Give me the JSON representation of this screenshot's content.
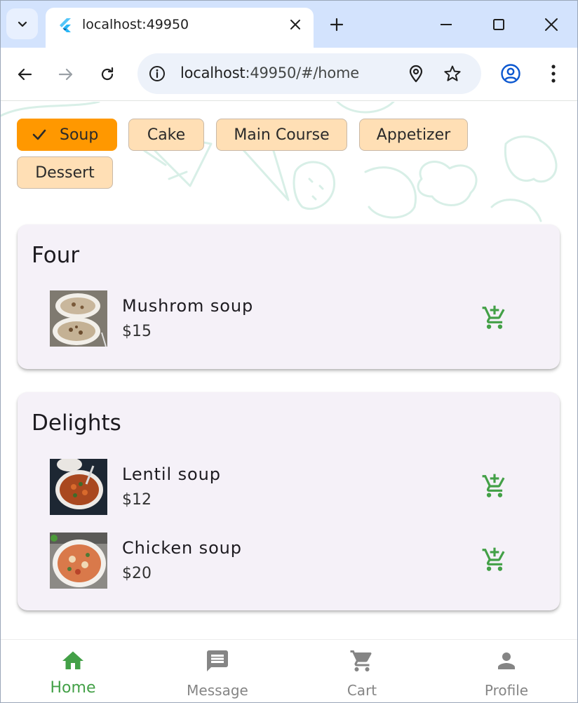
{
  "browser": {
    "tab_title": "localhost:49950",
    "url_host": "localhost",
    "url_path": ":49950/#/home"
  },
  "categories": {
    "selected": "Soup",
    "chips": [
      "Soup",
      "Cake",
      "Main Course",
      "Appetizer",
      "Dessert"
    ]
  },
  "sections": [
    {
      "title": "Four",
      "items": [
        {
          "name": "Mushrom soup",
          "price": "$15"
        }
      ]
    },
    {
      "title": "Delights",
      "items": [
        {
          "name": "Lentil soup",
          "price": "$12"
        },
        {
          "name": "Chicken soup",
          "price": "$20"
        }
      ]
    }
  ],
  "bottom_nav": {
    "items": [
      {
        "label": "Home",
        "icon": "home-icon"
      },
      {
        "label": "Message",
        "icon": "message-icon"
      },
      {
        "label": "Cart",
        "icon": "cart-icon"
      },
      {
        "label": "Profile",
        "icon": "person-icon"
      }
    ],
    "active": "Home"
  },
  "colors": {
    "accent_green": "#43a047",
    "chip_selected": "#ff9800",
    "chip_default": "#ffdfb5",
    "card_bg": "#f5f1f8"
  }
}
